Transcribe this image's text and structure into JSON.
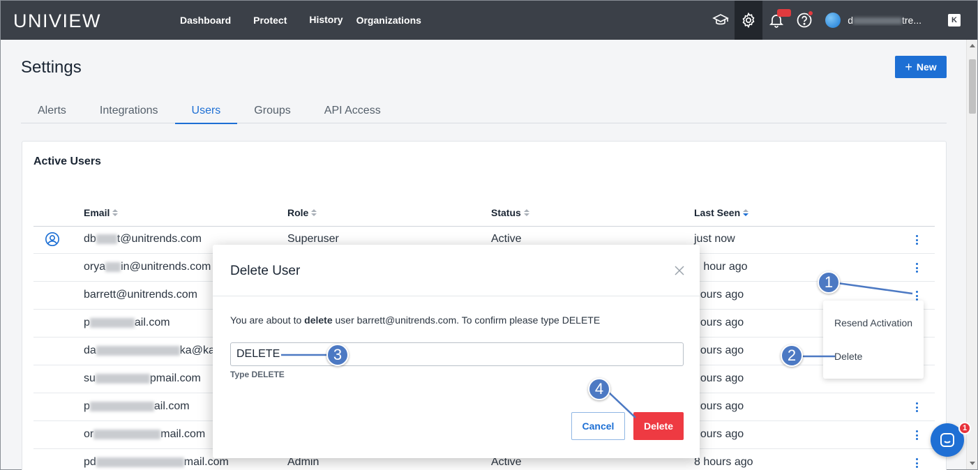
{
  "header": {
    "logo": "UNIVIEW",
    "nav": [
      {
        "label": "Dashboard"
      },
      {
        "label": "Protect"
      },
      {
        "label": "History"
      },
      {
        "label": "Organizations"
      }
    ],
    "user_name_start": "d",
    "user_name_end": "tre...",
    "tenant_badge": "K",
    "icons": [
      "graduation-cap-icon",
      "gear-icon",
      "bell-icon",
      "help-icon"
    ]
  },
  "page": {
    "title": "Settings",
    "new_button": "New",
    "tabs": [
      "Alerts",
      "Integrations",
      "Users",
      "Groups",
      "API Access"
    ],
    "active_tab": "Users"
  },
  "table": {
    "title": "Active Users",
    "columns": [
      "Email",
      "Role",
      "Status",
      "Last Seen"
    ],
    "rows": [
      {
        "email_start": "db",
        "email_end": "t@unitrends.com",
        "role": "Superuser",
        "status": "Active",
        "last_seen": "just now"
      },
      {
        "email_start": "orya",
        "email_end": "in@unitrends.com",
        "role": "",
        "status": "",
        "last_seen": "n hour ago"
      },
      {
        "email_start": "barrett@unitrends.com",
        "email_end": "",
        "role": "",
        "status": "",
        "last_seen": " hours ago"
      },
      {
        "email_start": "p",
        "email_end": "ail.com",
        "role": "",
        "status": "",
        "last_seen": " hours ago"
      },
      {
        "email_start": "da",
        "email_end": "ka@kas",
        "role": "",
        "status": "",
        "last_seen": " hours ago"
      },
      {
        "email_start": "su",
        "email_end": "pmail.com",
        "role": "",
        "status": "",
        "last_seen": " hours ago"
      },
      {
        "email_start": "p",
        "email_end": "ail.com",
        "role": "",
        "status": "",
        "last_seen": " hours ago"
      },
      {
        "email_start": "or",
        "email_end": "mail.com",
        "role": "",
        "status": "",
        "last_seen": " hours ago"
      },
      {
        "email_start": "pd",
        "email_end": "mail.com",
        "role": "Admin",
        "status": "Active",
        "last_seen": "8 hours ago"
      }
    ]
  },
  "context_menu": {
    "items": [
      "Resend Activation",
      "Delete"
    ]
  },
  "modal": {
    "title": "Delete User",
    "msg_pre": "You are about to ",
    "msg_bold": "delete",
    "msg_post": " user barrett@unitrends.com. To confirm please type DELETE",
    "input_value": "DELETE",
    "input_hint": "Type DELETE",
    "cancel": "Cancel",
    "delete": "Delete"
  },
  "callouts": [
    "1",
    "2",
    "3",
    "4"
  ],
  "chat": {
    "badge": "1"
  },
  "colors": {
    "accent": "#1d6fd4",
    "danger": "#ee3a42",
    "topbar": "#3b4048",
    "callout": "#4c79c3"
  }
}
